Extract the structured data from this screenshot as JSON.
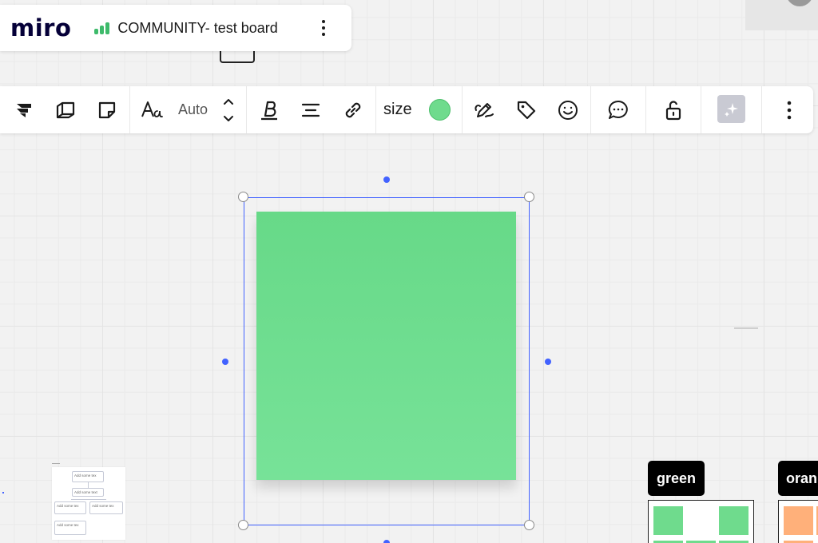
{
  "header": {
    "logo": "miro",
    "board_title": "COMMUNITY- test board",
    "signal_color": "#3dba6a"
  },
  "toolbar": {
    "items": [
      "jira-icon",
      "card-icon",
      "sticky-note-icon",
      "text-style-icon",
      "font-size-stepper",
      "bold-icon",
      "align-center-icon",
      "link-icon",
      "size",
      "color-swatch",
      "pen-icon",
      "tag-icon",
      "emoji-icon",
      "comment-icon",
      "unlock-icon",
      "ai-sparkle-icon",
      "more-icon"
    ],
    "font_size_value": "Auto",
    "size_label": "size",
    "selected_color": "#6fdb8d"
  },
  "canvas": {
    "sticky_color": "#6fdb8d",
    "selection_color": "#4262ff",
    "mini_diagram": {
      "nodes": [
        "Add some tex",
        "Add some text",
        "Add some tex",
        "Add some tex",
        "Add some tex"
      ]
    },
    "tags": [
      "green",
      "oran"
    ],
    "swatch_colors": {
      "green": "#6fdb8d",
      "orange": "#ffb07a"
    }
  }
}
